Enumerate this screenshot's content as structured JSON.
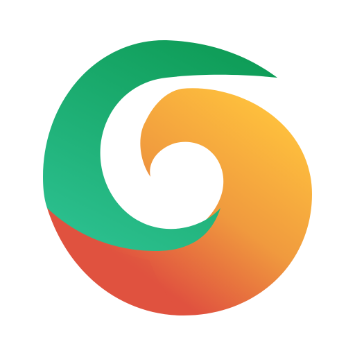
{
  "app_icon": {
    "icon": "swirl-logo-icon",
    "colors": {
      "background": "#ffffff",
      "green_dark": "#0f9d58",
      "green_light": "#2bbf8e",
      "orange_light": "#ffc23d",
      "orange_mid": "#f09a3e",
      "red": "#e0523f"
    }
  }
}
